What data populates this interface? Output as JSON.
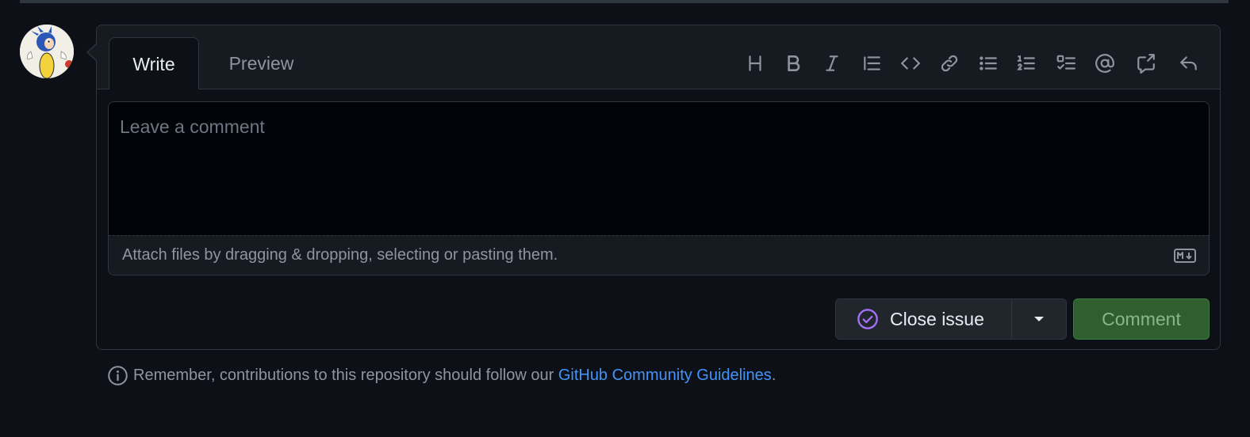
{
  "tabs": [
    {
      "label": "Write",
      "active": true
    },
    {
      "label": "Preview",
      "active": false
    }
  ],
  "toolbar": {
    "icons": [
      "heading-icon",
      "bold-icon",
      "italic-icon",
      "quote-icon",
      "code-icon",
      "link-icon",
      "unordered-list-icon",
      "ordered-list-icon",
      "task-list-icon",
      "mention-icon",
      "reference-icon",
      "reply-icon"
    ]
  },
  "editor": {
    "placeholder": "Leave a comment",
    "value": ""
  },
  "attach": {
    "text": "Attach files by dragging & dropping, selecting or pasting them.",
    "markdown_icon": "markdown-icon"
  },
  "actions": {
    "close_label": "Close issue",
    "comment_label": "Comment"
  },
  "footer": {
    "prefix": "Remember, contributions to this repository should follow our ",
    "link": "GitHub Community Guidelines",
    "suffix": "."
  },
  "colors": {
    "background": "#0d1117",
    "accent_link": "#4493f8",
    "close_icon": "#a371f7",
    "comment_button": "#2f5f2f"
  }
}
